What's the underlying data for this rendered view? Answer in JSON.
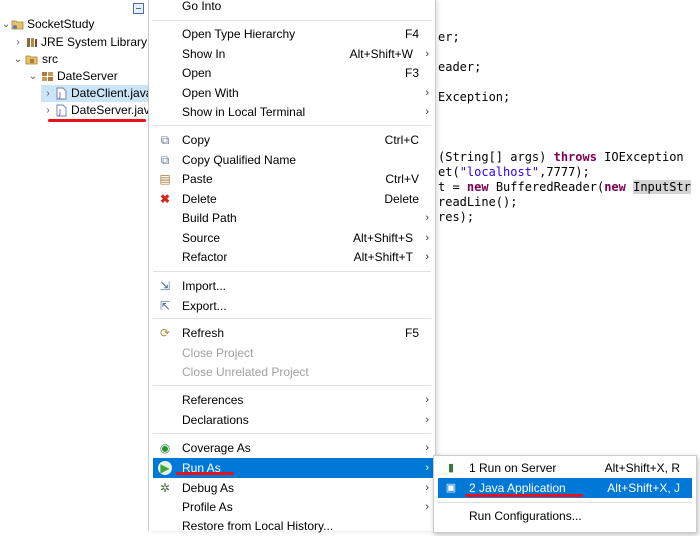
{
  "tree": {
    "project": "SocketStudy",
    "jre": "JRE System Library [J",
    "src": "src",
    "package": "DateServer",
    "file1": "DateClient.java",
    "file2": "DateServer.java"
  },
  "code": {
    "l1": "er;",
    "l2": "eader;",
    "l3": "Exception;",
    "l4a": "(String[] args) ",
    "l4kw": "throws",
    "l4b": " IOException",
    "l5a": "et(",
    "l5str": "\"localhost\"",
    "l5b": ",7777);",
    "l6a": "t = ",
    "l6kw": "new",
    "l6b": " BufferedReader(",
    "l6kw2": "new",
    "l6c": "InputStr",
    "l7": "readLine();",
    "l8": "res);"
  },
  "menu": {
    "go_into": "Go Into",
    "open_type_hierarchy": "Open Type Hierarchy",
    "open_type_hierarchy_acc": "F4",
    "show_in": "Show In",
    "show_in_acc": "Alt+Shift+W",
    "open": "Open",
    "open_acc": "F3",
    "open_with": "Open With",
    "show_in_local_terminal": "Show in Local Terminal",
    "copy": "Copy",
    "copy_acc": "Ctrl+C",
    "copy_qualified_name": "Copy Qualified Name",
    "paste": "Paste",
    "paste_acc": "Ctrl+V",
    "delete": "Delete",
    "delete_acc": "Delete",
    "build_path": "Build Path",
    "source": "Source",
    "source_acc": "Alt+Shift+S",
    "refactor": "Refactor",
    "refactor_acc": "Alt+Shift+T",
    "import": "Import...",
    "export": "Export...",
    "refresh": "Refresh",
    "refresh_acc": "F5",
    "close_project": "Close Project",
    "close_unrelated_project": "Close Unrelated Project",
    "references": "References",
    "declarations": "Declarations",
    "coverage_as": "Coverage As",
    "run_as": "Run As",
    "debug_as": "Debug As",
    "profile_as": "Profile As",
    "restore_from_local_history": "Restore from Local History..."
  },
  "submenu": {
    "run_on_server": "1 Run on Server",
    "run_on_server_acc": "Alt+Shift+X, R",
    "java_application": "2 Java Application",
    "java_application_acc": "Alt+Shift+X, J",
    "run_configurations": "Run Configurations..."
  },
  "colors": {
    "highlight": "#0078d7",
    "annotation": "#e8101a",
    "keyword": "#7f0055",
    "string": "#2a00ff"
  }
}
